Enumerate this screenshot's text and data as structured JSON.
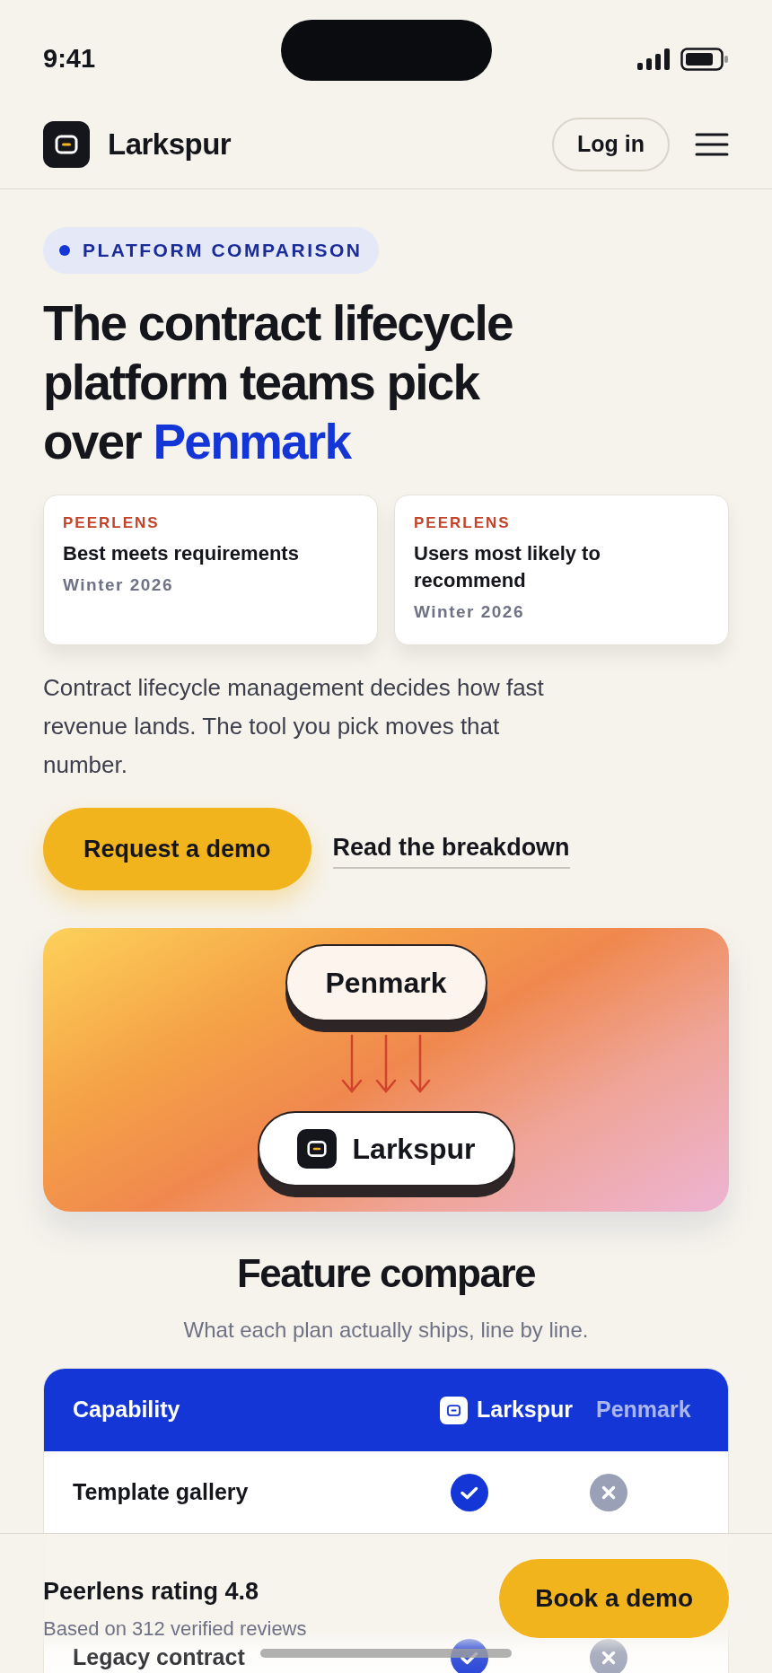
{
  "status_bar": {
    "time": "9:41"
  },
  "header": {
    "brand": "Larkspur",
    "login": "Log in"
  },
  "eyebrow": "PLATFORM COMPARISON",
  "headline": {
    "lead": "The contract lifecycle platform teams pick over ",
    "highlight": "Penmark"
  },
  "awards": [
    {
      "source": "PEERLENS",
      "title": "Best meets requirements",
      "season": "Winter 2026"
    },
    {
      "source": "PEERLENS",
      "title": "Users most likely to recommend",
      "season": "Winter 2026"
    }
  ],
  "intro": "Contract lifecycle management decides how fast revenue lands. The tool you pick moves that number.",
  "actions": {
    "primary": "Request a demo",
    "secondary": "Read the breakdown"
  },
  "hero": {
    "from": "Penmark",
    "to": "Larkspur"
  },
  "compare": {
    "title": "Feature compare",
    "subtitle": "What each plan actually ships, line by line.",
    "columns": [
      "Capability",
      "Larkspur",
      "Penmark"
    ],
    "rows": [
      {
        "feature": "Template gallery",
        "larkspur": true,
        "penmark": false
      },
      {
        "feature": "Legacy contract",
        "larkspur": true,
        "penmark": false
      }
    ]
  },
  "sticky_bar": {
    "rating": "Peerlens rating 4.8",
    "reviews": "Based on 312 verified reviews",
    "button": "Book a demo"
  }
}
